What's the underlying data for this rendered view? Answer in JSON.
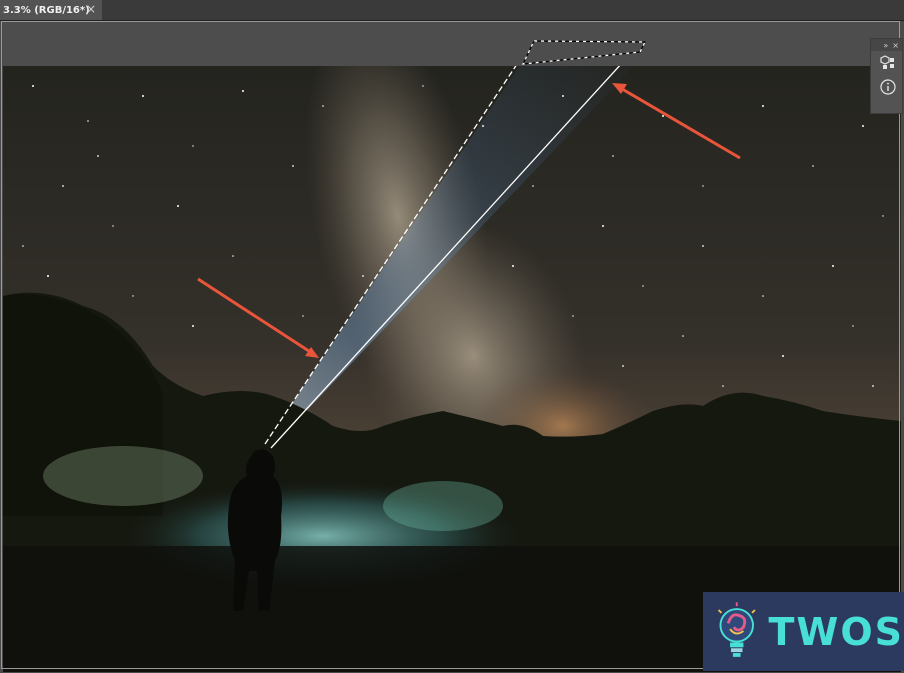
{
  "document_tab": {
    "title": "3.3% (RGB/16*)",
    "close_glyph": "×"
  },
  "panel": {
    "collapse_glyph": "»",
    "close_glyph": "×",
    "buttons": [
      {
        "icon": "libraries-icon"
      },
      {
        "icon": "info-icon"
      }
    ]
  },
  "logo": {
    "text": "TWOS"
  },
  "colors": {
    "annotation_arrow": "#e8553a",
    "logo_bg": "#2b3a5e",
    "logo_text": "#48e0d6"
  }
}
